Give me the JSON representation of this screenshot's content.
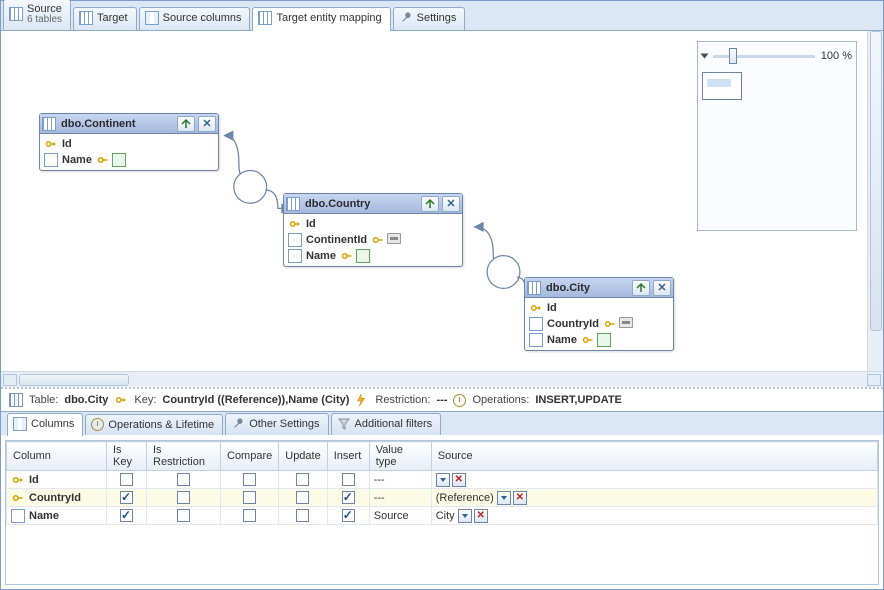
{
  "tabs": {
    "source": {
      "label": "Source",
      "sub": "6 tables"
    },
    "target": {
      "label": "Target"
    },
    "source_cols": {
      "label": "Source columns"
    },
    "target_map": {
      "label": "Target entity mapping"
    },
    "settings": {
      "label": "Settings"
    }
  },
  "zoom": {
    "value": "100 %"
  },
  "entities": {
    "continent": {
      "title": "dbo.Continent",
      "f0": "Id",
      "f1": "Name"
    },
    "country": {
      "title": "dbo.Country",
      "f0": "Id",
      "f1": "ContinentId",
      "f2": "Name"
    },
    "city": {
      "title": "dbo.City",
      "f0": "Id",
      "f1": "CountryId",
      "f2": "Name"
    }
  },
  "info": {
    "table_lbl": "Table:",
    "table_val": "dbo.City",
    "key_lbl": "Key:",
    "key_val": "CountryId ((Reference)),Name (City)",
    "restr_lbl": "Restriction:",
    "restr_val": "---",
    "ops_lbl": "Operations:",
    "ops_val": "INSERT,UPDATE"
  },
  "sub_tabs": {
    "columns": "Columns",
    "ops": "Operations & Lifetime",
    "other": "Other Settings",
    "filters": "Additional filters"
  },
  "grid": {
    "h_column": "Column",
    "h_iskey": "Is Key",
    "h_isrestr": "Is Restriction",
    "h_compare": "Compare",
    "h_update": "Update",
    "h_insert": "Insert",
    "h_vtype": "Value type",
    "h_source": "Source",
    "r0": {
      "name": "Id",
      "vtype": "---",
      "source": ""
    },
    "r1": {
      "name": "CountryId",
      "vtype": "---",
      "source": "(Reference)"
    },
    "r2": {
      "name": "Name",
      "vtype": "Source",
      "source": "City"
    }
  }
}
